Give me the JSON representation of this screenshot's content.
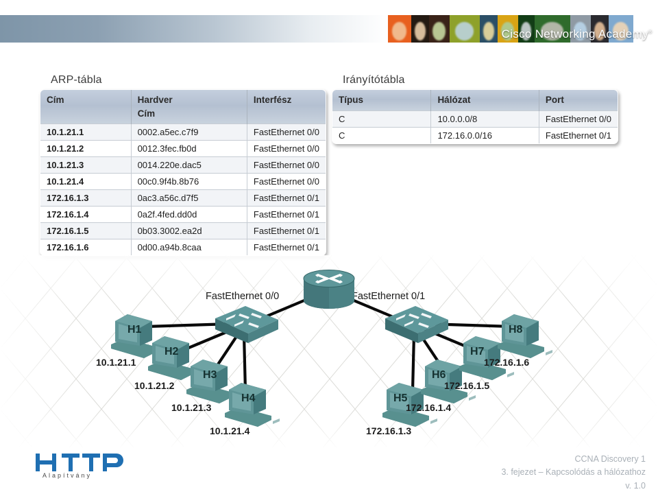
{
  "header": {
    "brand": "Cisco Networking Academy",
    "trademark": "®",
    "collage_colors": [
      "#e8601f",
      "#241a12",
      "#3a2318",
      "#8ea12a",
      "#2b4f66",
      "#d9a415",
      "#123d16",
      "#2f6b2c",
      "#8f9aa4",
      "#2a2a2f",
      "#7fa9cf"
    ]
  },
  "arp_table": {
    "title": "ARP-tábla",
    "headers": [
      "Cím",
      "Hardver\nCím",
      "Interfész"
    ],
    "header_line1": [
      "Cím",
      "Hardver",
      "Interfész"
    ],
    "header_line2": [
      "",
      "Cím",
      ""
    ],
    "rows": [
      [
        "10.1.21.1",
        "0002.a5ec.c7f9",
        "FastEthernet 0/0"
      ],
      [
        "10.1.21.2",
        "0012.3fec.fb0d",
        "FastEthernet 0/0"
      ],
      [
        "10.1.21.3",
        "0014.220e.dac5",
        "FastEthernet 0/0"
      ],
      [
        "10.1.21.4",
        "00c0.9f4b.8b76",
        "FastEthernet 0/0"
      ],
      [
        "172.16.1.3",
        "0ac3.a56c.d7f5",
        "FastEthernet 0/1"
      ],
      [
        "172.16.1.4",
        "0a2f.4fed.dd0d",
        "FastEthernet 0/1"
      ],
      [
        "172.16.1.5",
        "0b03.3002.ea2d",
        "FastEthernet 0/1"
      ],
      [
        "172.16.1.6",
        "0d00.a94b.8caa",
        "FastEthernet 0/1"
      ]
    ]
  },
  "routing_table": {
    "title": "Irányítótábla",
    "headers": [
      "Típus",
      "Hálózat",
      "Port"
    ],
    "rows": [
      [
        "C",
        "10.0.0.0/8",
        "FastEthernet 0/0"
      ],
      [
        "C",
        "172.16.0.0/16",
        "FastEthernet 0/1"
      ]
    ]
  },
  "diagram": {
    "interface_left": "FastEthernet 0/0",
    "interface_right": "FastEthernet 0/1",
    "router_name": "router",
    "switch_left_name": "switch-left",
    "switch_right_name": "switch-right",
    "hosts_left": [
      {
        "name": "H1",
        "ip": "10.1.21.1"
      },
      {
        "name": "H2",
        "ip": "10.1.21.2"
      },
      {
        "name": "H3",
        "ip": "10.1.21.3"
      },
      {
        "name": "H4",
        "ip": "10.1.21.4"
      }
    ],
    "hosts_right": [
      {
        "name": "H5",
        "ip": "172.16.1.3"
      },
      {
        "name": "H6",
        "ip": "172.16.1.4"
      },
      {
        "name": "H7",
        "ip": "172.16.1.5"
      },
      {
        "name": "H8",
        "ip": "172.16.1.6"
      }
    ],
    "device_color": "#4d8487",
    "link_color": "#000000"
  },
  "footer": {
    "logo_text": "HTTP",
    "logo_subtext": "Alapítvány",
    "line1": "CCNA Discovery 1",
    "line2": "3. fejezet – Kapcsolódás a hálózathoz",
    "line3": "v. 1.0"
  }
}
